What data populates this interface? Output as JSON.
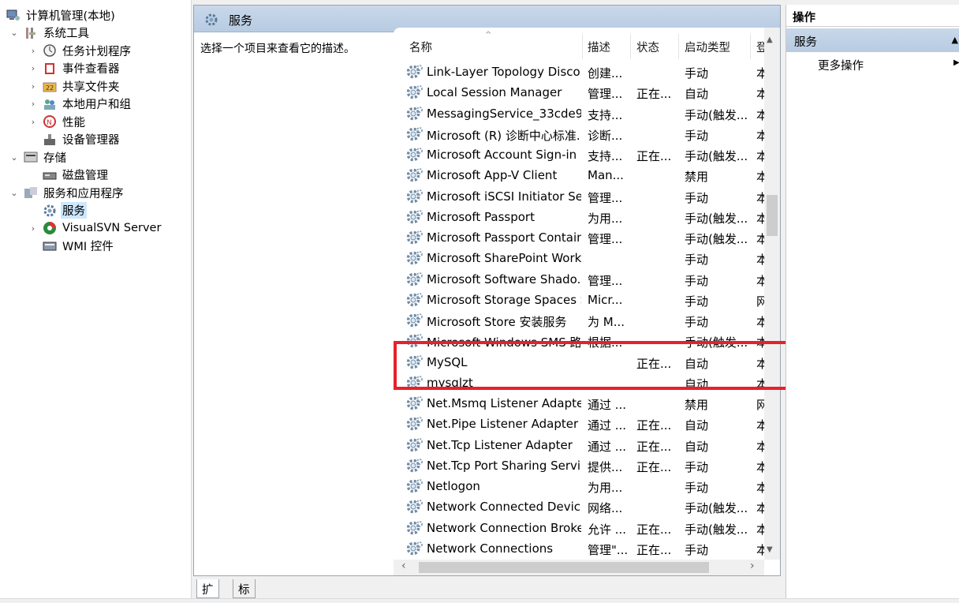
{
  "tree": {
    "items": [
      {
        "label": "计算机管理(本地)",
        "arrow": "",
        "icon": "computer-management-icon",
        "level": 0
      },
      {
        "label": "系统工具",
        "arrow": "⌄",
        "icon": "system-tools-icon",
        "level": 1
      },
      {
        "label": "任务计划程序",
        "arrow": "›",
        "icon": "task-scheduler-icon",
        "level": 2
      },
      {
        "label": "事件查看器",
        "arrow": "›",
        "icon": "event-viewer-icon",
        "level": 2
      },
      {
        "label": "共享文件夹",
        "arrow": "›",
        "icon": "shared-folders-icon",
        "level": 2
      },
      {
        "label": "本地用户和组",
        "arrow": "›",
        "icon": "local-users-icon",
        "level": 2
      },
      {
        "label": "性能",
        "arrow": "›",
        "icon": "performance-icon",
        "level": 2
      },
      {
        "label": "设备管理器",
        "arrow": "",
        "icon": "device-manager-icon",
        "level": 2
      },
      {
        "label": "存储",
        "arrow": "⌄",
        "icon": "storage-icon",
        "level": 1
      },
      {
        "label": "磁盘管理",
        "arrow": "",
        "icon": "disk-management-icon",
        "level": 2
      },
      {
        "label": "服务和应用程序",
        "arrow": "⌄",
        "icon": "services-apps-icon",
        "level": 1
      },
      {
        "label": "服务",
        "arrow": "",
        "icon": "services-gear-icon",
        "level": 2,
        "selected": true
      },
      {
        "label": "VisualSVN Server",
        "arrow": "›",
        "icon": "visualsvn-icon",
        "level": 2
      },
      {
        "label": "WMI 控件",
        "arrow": "",
        "icon": "wmi-icon",
        "level": 2
      }
    ]
  },
  "middle": {
    "title": "服务",
    "description": "选择一个项目来查看它的描述。",
    "columns": {
      "name": "名称",
      "desc": "描述",
      "status": "状态",
      "startup": "启动类型",
      "logon": "登"
    },
    "rows": [
      {
        "name": "Link-Layer Topology Disco...",
        "desc": "创建...",
        "status": "",
        "startup": "手动",
        "logon": "本"
      },
      {
        "name": "Local Session Manager",
        "desc": "管理...",
        "status": "正在...",
        "startup": "自动",
        "logon": "本"
      },
      {
        "name": "MessagingService_33cde9...",
        "desc": "支持...",
        "status": "",
        "startup": "手动(触发...",
        "logon": "本"
      },
      {
        "name": "Microsoft (R) 诊断中心标准...",
        "desc": "诊断...",
        "status": "",
        "startup": "手动",
        "logon": "本"
      },
      {
        "name": "Microsoft Account Sign-in ...",
        "desc": "支持...",
        "status": "正在...",
        "startup": "手动(触发...",
        "logon": "本"
      },
      {
        "name": "Microsoft App-V Client",
        "desc": "Man...",
        "status": "",
        "startup": "禁用",
        "logon": "本"
      },
      {
        "name": "Microsoft iSCSI Initiator Ser...",
        "desc": "管理...",
        "status": "",
        "startup": "手动",
        "logon": "本"
      },
      {
        "name": "Microsoft Passport",
        "desc": "为用...",
        "status": "",
        "startup": "手动(触发...",
        "logon": "本"
      },
      {
        "name": "Microsoft Passport Container",
        "desc": "管理...",
        "status": "",
        "startup": "手动(触发...",
        "logon": "本"
      },
      {
        "name": "Microsoft SharePoint Work...",
        "desc": "",
        "status": "",
        "startup": "手动",
        "logon": "本"
      },
      {
        "name": "Microsoft Software Shado...",
        "desc": "管理...",
        "status": "",
        "startup": "手动",
        "logon": "本"
      },
      {
        "name": "Microsoft Storage Spaces S...",
        "desc": "Micr...",
        "status": "",
        "startup": "手动",
        "logon": "网"
      },
      {
        "name": "Microsoft Store 安装服务",
        "desc": "为 M...",
        "status": "",
        "startup": "手动",
        "logon": "本"
      },
      {
        "name": "Microsoft Windows SMS 路...",
        "desc": "根据...",
        "status": "",
        "startup": "手动(触发...",
        "logon": "本"
      },
      {
        "name": "MySQL",
        "desc": "",
        "status": "正在...",
        "startup": "自动",
        "logon": "本"
      },
      {
        "name": "mysqlzt",
        "desc": "",
        "status": "",
        "startup": "自动",
        "logon": "本"
      },
      {
        "name": "Net.Msmq Listener Adapter",
        "desc": "通过 ...",
        "status": "",
        "startup": "禁用",
        "logon": "网"
      },
      {
        "name": "Net.Pipe Listener Adapter",
        "desc": "通过 ...",
        "status": "正在...",
        "startup": "自动",
        "logon": "本"
      },
      {
        "name": "Net.Tcp Listener Adapter",
        "desc": "通过 ...",
        "status": "正在...",
        "startup": "自动",
        "logon": "本"
      },
      {
        "name": "Net.Tcp Port Sharing Service",
        "desc": "提供...",
        "status": "正在...",
        "startup": "手动",
        "logon": "本"
      },
      {
        "name": "Netlogon",
        "desc": "为用...",
        "status": "",
        "startup": "手动",
        "logon": "本"
      },
      {
        "name": "Network Connected Devic...",
        "desc": "网络...",
        "status": "",
        "startup": "手动(触发...",
        "logon": "本"
      },
      {
        "name": "Network Connection Broker",
        "desc": "允许 ...",
        "status": "正在...",
        "startup": "手动(触发...",
        "logon": "本"
      },
      {
        "name": "Network Connections",
        "desc": "管理\"...",
        "status": "正在...",
        "startup": "手动",
        "logon": "本"
      }
    ],
    "tabs": {
      "extended": "扩展",
      "standard": "标准"
    }
  },
  "actions": {
    "title": "操作",
    "section": "服务",
    "more": "更多操作"
  },
  "colors": {
    "highlight": "#e8202a",
    "header_blue": "#c9d8ea",
    "selected": "#cce8ff"
  }
}
